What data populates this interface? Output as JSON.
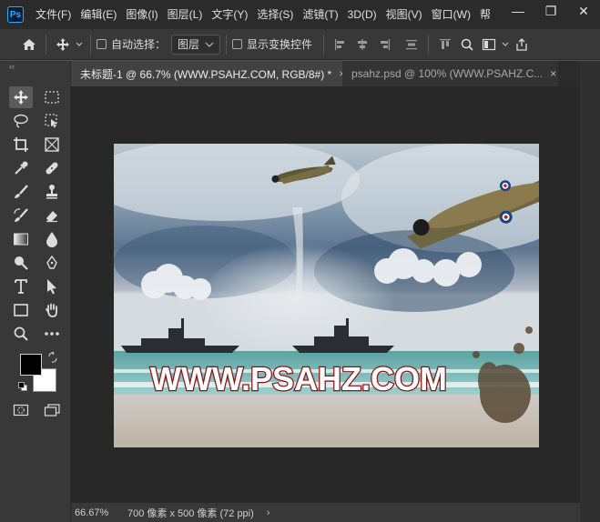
{
  "app": {
    "logo": "Ps"
  },
  "menu": {
    "items": [
      "文件(F)",
      "编辑(E)",
      "图像(I)",
      "图层(L)",
      "文字(Y)",
      "选择(S)",
      "滤镜(T)",
      "3D(D)",
      "视图(V)",
      "窗口(W)",
      "帮"
    ]
  },
  "window_controls": {
    "minimize": "—",
    "restore": "❐",
    "close": "✕"
  },
  "options": {
    "auto_select_label": "自动选择：",
    "layer_dropdown": "图层",
    "show_transform_label": "显示变换控件"
  },
  "tabs": [
    {
      "label": "未标题-1 @ 66.7% (WWW.PSAHZ.COM, RGB/8#) *",
      "close": "×"
    },
    {
      "label": "psahz.psd @ 100% (WWW.PSAHZ.C...",
      "close": "×"
    }
  ],
  "toolbar": {
    "collapse": "‹‹"
  },
  "artwork": {
    "watermark": "WWW.PSAHZ.COM"
  },
  "status": {
    "zoom": "66.67%",
    "info": "700 像素 x 500 像素 (72 ppi)",
    "arrow": "›"
  },
  "colors": {
    "menubar": "#2b2b2b",
    "panel": "#383838",
    "workspace": "#282828",
    "accent": "#31a8ff",
    "watermark_fill": "#ffffff",
    "watermark_stroke": "#8a1010"
  }
}
